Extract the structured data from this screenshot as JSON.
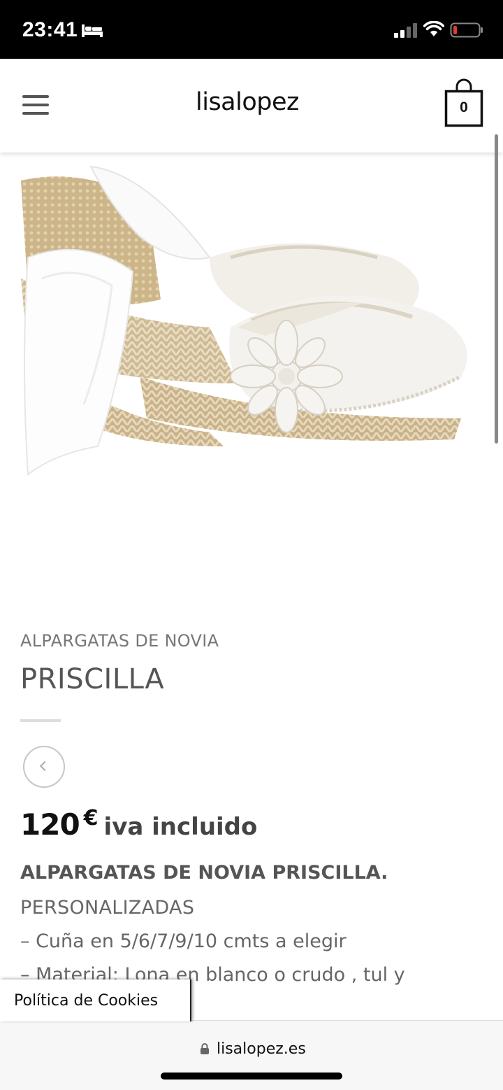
{
  "status_bar": {
    "time": "23:41",
    "icons": [
      "bed-icon",
      "signal-icon",
      "wifi-icon",
      "battery-low-icon"
    ],
    "battery_color": "#e23b2e"
  },
  "header": {
    "logo": "lisalopez",
    "cart_count": "0",
    "icons": [
      "menu-icon",
      "cart-bag-icon"
    ]
  },
  "product": {
    "image_alt": "white bridal espadrilles with lace flower and ribbon",
    "category": "ALPARGATAS DE NOVIA",
    "title": "PRISCILLA",
    "price_amount": "120",
    "price_currency": "€",
    "price_tax_note": "iva incluido",
    "description_title": "ALPARGATAS DE NOVIA PRISCILLA.",
    "description_lines": [
      "PERSONALIZADAS",
      "– Cuña en 5/6/7/9/10 cmts a elegir",
      "– Material: Lona en blanco o crudo , tul y"
    ]
  },
  "cookie_tab": {
    "label": "Política de Cookies"
  },
  "browser": {
    "url": "lisalopez.es"
  }
}
